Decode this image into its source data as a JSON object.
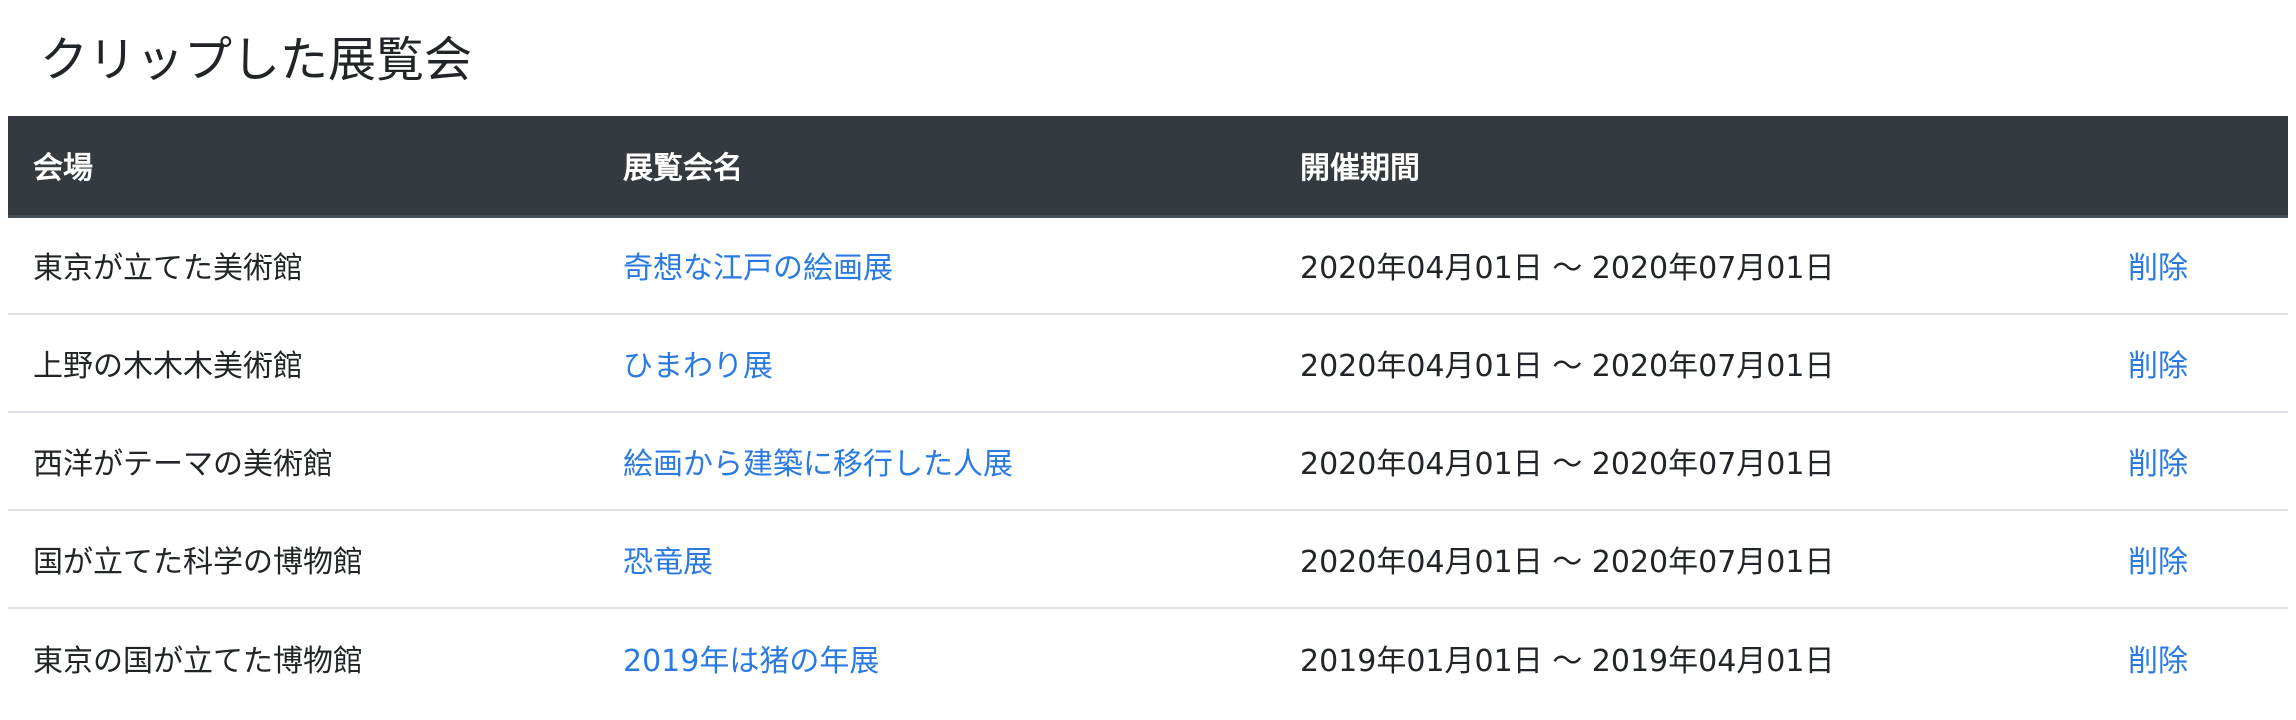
{
  "page": {
    "title": "クリップした展覧会"
  },
  "table": {
    "headers": {
      "venue": "会場",
      "exhibition": "展覧会名",
      "period": "開催期間",
      "action": ""
    },
    "rows": [
      {
        "venue": "東京が立てた美術館",
        "exhibition": "奇想な江戸の絵画展",
        "period": "2020年04月01日 〜 2020年07月01日",
        "action": "削除"
      },
      {
        "venue": "上野の木木木美術館",
        "exhibition": "ひまわり展",
        "period": "2020年04月01日 〜 2020年07月01日",
        "action": "削除"
      },
      {
        "venue": "西洋がテーマの美術館",
        "exhibition": "絵画から建築に移行した人展",
        "period": "2020年04月01日 〜 2020年07月01日",
        "action": "削除"
      },
      {
        "venue": "国が立てた科学の博物館",
        "exhibition": "恐竜展",
        "period": "2020年04月01日 〜 2020年07月01日",
        "action": "削除"
      },
      {
        "venue": "東京の国が立てた博物館",
        "exhibition": "2019年は猪の年展",
        "period": "2019年01月01日 〜 2019年04月01日",
        "action": "削除"
      }
    ]
  },
  "colors": {
    "header_background": "#343a40",
    "link": "#2a7ae2",
    "row_divider": "#dee2e6"
  }
}
